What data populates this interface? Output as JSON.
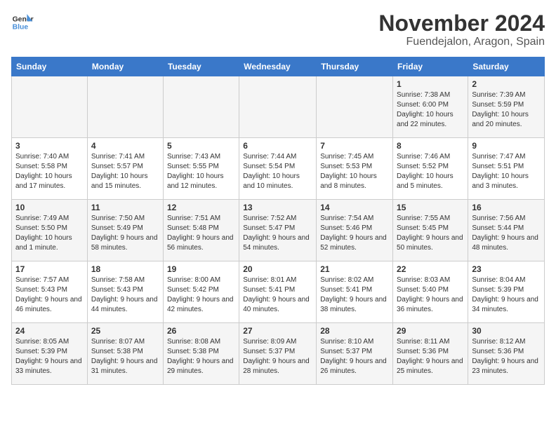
{
  "logo": {
    "line1": "General",
    "line2": "Blue"
  },
  "title": "November 2024",
  "location": "Fuendejalon, Aragon, Spain",
  "days_of_week": [
    "Sunday",
    "Monday",
    "Tuesday",
    "Wednesday",
    "Thursday",
    "Friday",
    "Saturday"
  ],
  "weeks": [
    [
      {
        "day": "",
        "info": ""
      },
      {
        "day": "",
        "info": ""
      },
      {
        "day": "",
        "info": ""
      },
      {
        "day": "",
        "info": ""
      },
      {
        "day": "",
        "info": ""
      },
      {
        "day": "1",
        "info": "Sunrise: 7:38 AM\nSunset: 6:00 PM\nDaylight: 10 hours and 22 minutes."
      },
      {
        "day": "2",
        "info": "Sunrise: 7:39 AM\nSunset: 5:59 PM\nDaylight: 10 hours and 20 minutes."
      }
    ],
    [
      {
        "day": "3",
        "info": "Sunrise: 7:40 AM\nSunset: 5:58 PM\nDaylight: 10 hours and 17 minutes."
      },
      {
        "day": "4",
        "info": "Sunrise: 7:41 AM\nSunset: 5:57 PM\nDaylight: 10 hours and 15 minutes."
      },
      {
        "day": "5",
        "info": "Sunrise: 7:43 AM\nSunset: 5:55 PM\nDaylight: 10 hours and 12 minutes."
      },
      {
        "day": "6",
        "info": "Sunrise: 7:44 AM\nSunset: 5:54 PM\nDaylight: 10 hours and 10 minutes."
      },
      {
        "day": "7",
        "info": "Sunrise: 7:45 AM\nSunset: 5:53 PM\nDaylight: 10 hours and 8 minutes."
      },
      {
        "day": "8",
        "info": "Sunrise: 7:46 AM\nSunset: 5:52 PM\nDaylight: 10 hours and 5 minutes."
      },
      {
        "day": "9",
        "info": "Sunrise: 7:47 AM\nSunset: 5:51 PM\nDaylight: 10 hours and 3 minutes."
      }
    ],
    [
      {
        "day": "10",
        "info": "Sunrise: 7:49 AM\nSunset: 5:50 PM\nDaylight: 10 hours and 1 minute."
      },
      {
        "day": "11",
        "info": "Sunrise: 7:50 AM\nSunset: 5:49 PM\nDaylight: 9 hours and 58 minutes."
      },
      {
        "day": "12",
        "info": "Sunrise: 7:51 AM\nSunset: 5:48 PM\nDaylight: 9 hours and 56 minutes."
      },
      {
        "day": "13",
        "info": "Sunrise: 7:52 AM\nSunset: 5:47 PM\nDaylight: 9 hours and 54 minutes."
      },
      {
        "day": "14",
        "info": "Sunrise: 7:54 AM\nSunset: 5:46 PM\nDaylight: 9 hours and 52 minutes."
      },
      {
        "day": "15",
        "info": "Sunrise: 7:55 AM\nSunset: 5:45 PM\nDaylight: 9 hours and 50 minutes."
      },
      {
        "day": "16",
        "info": "Sunrise: 7:56 AM\nSunset: 5:44 PM\nDaylight: 9 hours and 48 minutes."
      }
    ],
    [
      {
        "day": "17",
        "info": "Sunrise: 7:57 AM\nSunset: 5:43 PM\nDaylight: 9 hours and 46 minutes."
      },
      {
        "day": "18",
        "info": "Sunrise: 7:58 AM\nSunset: 5:43 PM\nDaylight: 9 hours and 44 minutes."
      },
      {
        "day": "19",
        "info": "Sunrise: 8:00 AM\nSunset: 5:42 PM\nDaylight: 9 hours and 42 minutes."
      },
      {
        "day": "20",
        "info": "Sunrise: 8:01 AM\nSunset: 5:41 PM\nDaylight: 9 hours and 40 minutes."
      },
      {
        "day": "21",
        "info": "Sunrise: 8:02 AM\nSunset: 5:41 PM\nDaylight: 9 hours and 38 minutes."
      },
      {
        "day": "22",
        "info": "Sunrise: 8:03 AM\nSunset: 5:40 PM\nDaylight: 9 hours and 36 minutes."
      },
      {
        "day": "23",
        "info": "Sunrise: 8:04 AM\nSunset: 5:39 PM\nDaylight: 9 hours and 34 minutes."
      }
    ],
    [
      {
        "day": "24",
        "info": "Sunrise: 8:05 AM\nSunset: 5:39 PM\nDaylight: 9 hours and 33 minutes."
      },
      {
        "day": "25",
        "info": "Sunrise: 8:07 AM\nSunset: 5:38 PM\nDaylight: 9 hours and 31 minutes."
      },
      {
        "day": "26",
        "info": "Sunrise: 8:08 AM\nSunset: 5:38 PM\nDaylight: 9 hours and 29 minutes."
      },
      {
        "day": "27",
        "info": "Sunrise: 8:09 AM\nSunset: 5:37 PM\nDaylight: 9 hours and 28 minutes."
      },
      {
        "day": "28",
        "info": "Sunrise: 8:10 AM\nSunset: 5:37 PM\nDaylight: 9 hours and 26 minutes."
      },
      {
        "day": "29",
        "info": "Sunrise: 8:11 AM\nSunset: 5:36 PM\nDaylight: 9 hours and 25 minutes."
      },
      {
        "day": "30",
        "info": "Sunrise: 8:12 AM\nSunset: 5:36 PM\nDaylight: 9 hours and 23 minutes."
      }
    ]
  ]
}
